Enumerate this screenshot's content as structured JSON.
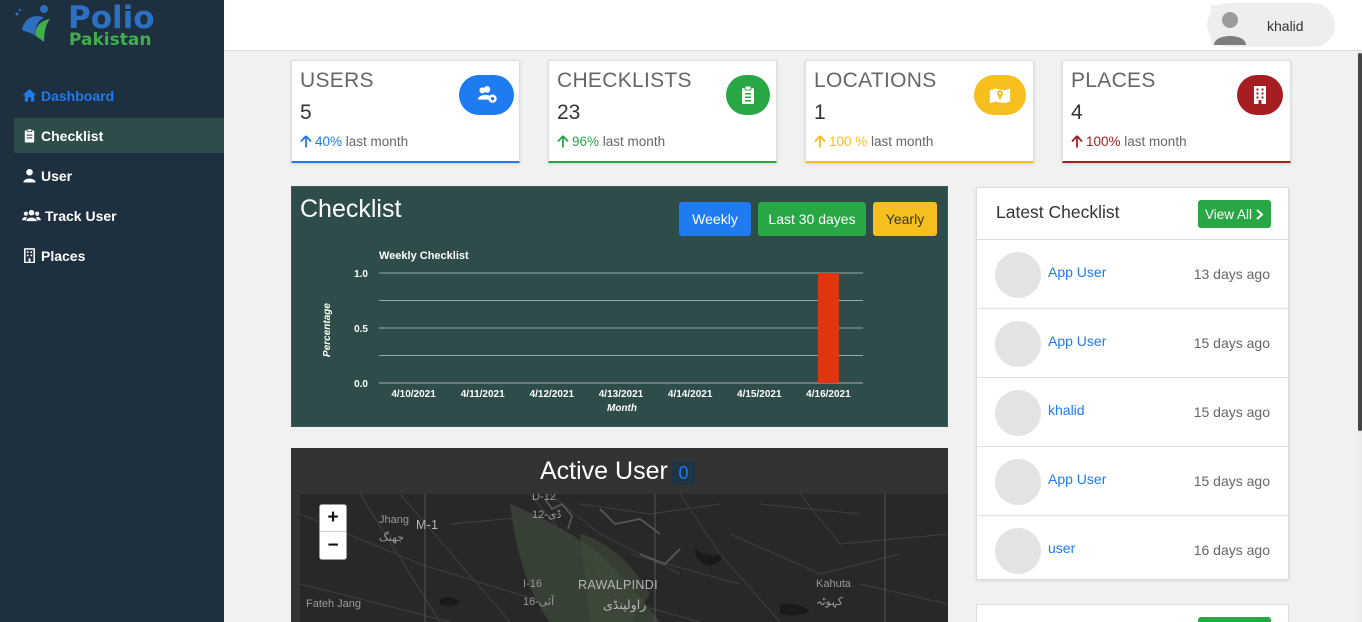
{
  "brand": {
    "title": "Polio",
    "subtitle": "Pakistan"
  },
  "sidebar": {
    "items": [
      {
        "label": "Dashboard",
        "icon": "home-icon"
      },
      {
        "label": "Checklist",
        "icon": "clipboard-icon"
      },
      {
        "label": "User",
        "icon": "user-icon"
      },
      {
        "label": "Track User",
        "icon": "users-icon"
      },
      {
        "label": "Places",
        "icon": "building-icon"
      }
    ]
  },
  "header": {
    "username": "khalid"
  },
  "stats": [
    {
      "label": "USERS",
      "value": "5",
      "percent": "40%",
      "suffix": "last month",
      "color": "#1e7bf0"
    },
    {
      "label": "CHECKLISTS",
      "value": "23",
      "percent": "96%",
      "suffix": "last month",
      "color": "#28a745"
    },
    {
      "label": "LOCATIONS",
      "value": "1",
      "percent": "100 %",
      "suffix": "last month",
      "color": "#f6bf1d"
    },
    {
      "label": "PLACES",
      "value": "4",
      "percent": "100%",
      "suffix": "last month",
      "color": "#a61e22"
    }
  ],
  "checklist_panel": {
    "title": "Checklist",
    "buttons": {
      "weekly": "Weekly",
      "last30": "Last 30 dayes",
      "yearly": "Yearly"
    }
  },
  "chart_data": {
    "type": "bar",
    "title": "Weekly Checklist",
    "xlabel": "Month",
    "ylabel": "Percentage",
    "categories": [
      "4/10/2021",
      "4/11/2021",
      "4/12/2021",
      "4/13/2021",
      "4/14/2021",
      "4/15/2021",
      "4/16/2021"
    ],
    "values": [
      0,
      0,
      0,
      0,
      0,
      0,
      1.0
    ],
    "ylim": [
      0,
      1.0
    ],
    "yticks": [
      "0.0",
      "0.5",
      "1.0"
    ],
    "bar_color": "#e0360f",
    "grid": true
  },
  "map_panel": {
    "title": "Active User",
    "count": "0",
    "zoom_in": "+",
    "zoom_out": "−",
    "labels": {
      "jhang": "Jhang",
      "jhang_ur": "جھنگ",
      "m1": "M-1",
      "d12": "D-12",
      "d12_ur": "ڈی-12",
      "i16": "I-16",
      "i16_ur": "آئی-16",
      "rawalpindi": "RAWALPINDI",
      "rawalpindi_ur": "راولپنڈی",
      "kahuta": "Kahuta",
      "kahuta_ur": "کہوٹہ",
      "fateh_jang": "Fateh Jang"
    }
  },
  "latest": {
    "title": "Latest Checklist",
    "view_all": "View All",
    "rows": [
      {
        "name": "App User",
        "time": "13 days ago"
      },
      {
        "name": "App User",
        "time": "15 days ago"
      },
      {
        "name": "khalid",
        "time": "15 days ago"
      },
      {
        "name": "App User",
        "time": "15 days ago"
      },
      {
        "name": "user",
        "time": "16 days ago"
      }
    ]
  }
}
